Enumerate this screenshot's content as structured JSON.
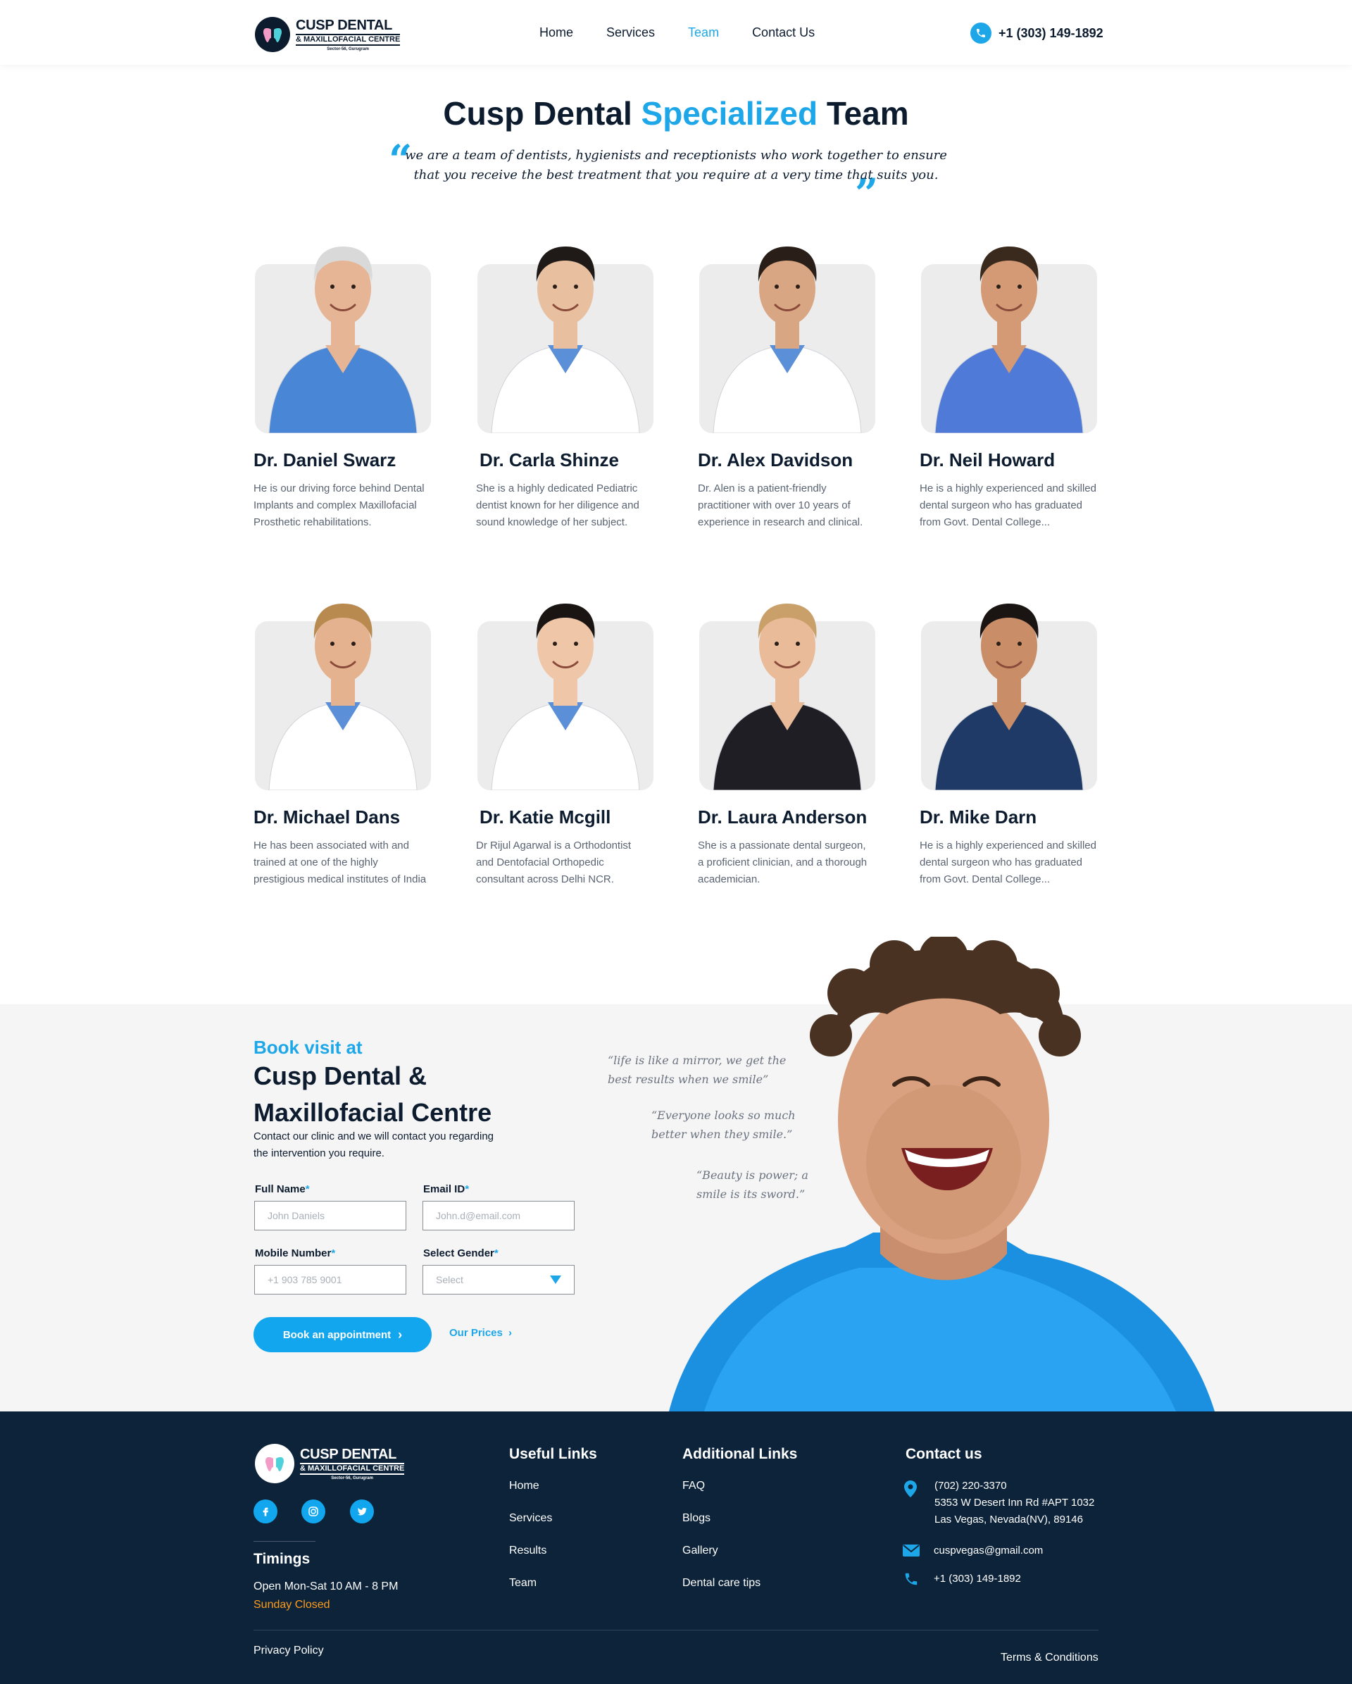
{
  "header": {
    "logo": {
      "name": "CUSP DENTAL",
      "sub": "& MAXILLOFACIAL CENTRE",
      "loc": "Sector-56, Gurugram"
    },
    "nav": [
      "Home",
      "Services",
      "Team",
      "Contact Us"
    ],
    "active_nav": "Team",
    "phone": "+1 (303) 149-1892"
  },
  "hero": {
    "title_start": "Cusp Dental ",
    "title_highlight": "Specialized",
    "title_end": " Team",
    "intro_line1": "we are a team of dentists, hygienists and receptionists who work together to ensure",
    "intro_line2": "that you receive the best treatment that you require at a very time that suits you."
  },
  "team": [
    {
      "name": "Dr. Daniel Swarz",
      "desc": [
        "He is our driving force behind Dental",
        "Implants and complex Maxillofacial",
        "Prosthetic rehabilitations."
      ]
    },
    {
      "name": "Dr. Carla Shinze",
      "desc": [
        "She is a highly dedicated Pediatric",
        "dentist known for her diligence and",
        "sound knowledge of her subject."
      ]
    },
    {
      "name": "Dr. Alex Davidson",
      "desc": [
        "Dr. Alen is a patient-friendly",
        "practitioner with over 10 years of",
        "experience in research and clinical."
      ]
    },
    {
      "name": "Dr. Neil Howard",
      "desc": [
        "He is a highly experienced and skilled",
        "dental surgeon who has graduated",
        "from Govt. Dental College..."
      ]
    },
    {
      "name": "Dr. Michael Dans",
      "desc": [
        "He has been associated with and",
        "trained at one of the highly",
        "prestigious medical institutes of India"
      ]
    },
    {
      "name": "Dr. Katie Mcgill",
      "desc": [
        "Dr Rijul Agarwal is a Orthodontist",
        "and Dentofacial Orthopedic",
        "consultant across Delhi NCR."
      ]
    },
    {
      "name": "Dr. Laura Anderson",
      "desc": [
        "She is a passionate dental surgeon,",
        "a proficient clinician, and a thorough",
        "academician."
      ]
    },
    {
      "name": "Dr. Mike Darn",
      "desc": [
        "He is a highly experienced and skilled",
        "dental surgeon who has graduated",
        "from Govt. Dental College..."
      ]
    }
  ],
  "booking": {
    "kicker": "Book visit at",
    "title_line1": "Cusp Dental &",
    "title_line2": "Maxillofacial Centre",
    "text_line1": "Contact our clinic and we will contact you regarding",
    "text_line2": "the intervention you require.",
    "full_name_label": "Full Name",
    "full_name_placeholder": "John Daniels",
    "email_label": "Email ID",
    "email_placeholder": "John.d@email.com",
    "mobile_label": "Mobile Number",
    "mobile_placeholder": "+1 903 785 9001",
    "gender_label": "Select Gender",
    "gender_value": "Select",
    "required_mark": "*",
    "book_button": "Book an appointment",
    "prices_link": "Our Prices"
  },
  "testimonials": [
    {
      "line1": "“life is like a mirror, we get the",
      "line2": "best results when we smile”"
    },
    {
      "line1": "“Everyone looks so much",
      "line2": "better when they smile.”"
    },
    {
      "line1": "“Beauty is power; a",
      "line2": "smile is its sword.”"
    }
  ],
  "footer": {
    "logo": {
      "name": "CUSP DENTAL",
      "sub": "& MAXILLOFACIAL CENTRE",
      "loc": "Sector-56, Gurugram"
    },
    "timings_title": "Timings",
    "timings_text": "Open Mon-Sat 10 AM - 8 PM",
    "timings_closed": "Sunday Closed",
    "useful_title": "Useful Links",
    "useful_links": [
      "Home",
      "Services",
      "Results",
      "Team"
    ],
    "additional_title": "Additional Links",
    "additional_links": [
      "FAQ",
      "Blogs",
      "Gallery",
      "Dental care tips"
    ],
    "contact_title": "Contact us",
    "contact_phone1": "(702) 220-3370",
    "contact_address1": "5353 W Desert Inn Rd #APT 1032",
    "contact_address2": "Las Vegas, Nevada(NV), 89146",
    "contact_email": "cuspvegas@gmail.com",
    "contact_phone2": "+1 (303) 149-1892",
    "privacy": "Privacy Policy",
    "terms": "Terms & Conditions"
  },
  "colors": {
    "accent": "#1ea7e8",
    "navy": "#0c1b2e",
    "footer": "#0c233a",
    "orange": "#ff9c1a"
  }
}
